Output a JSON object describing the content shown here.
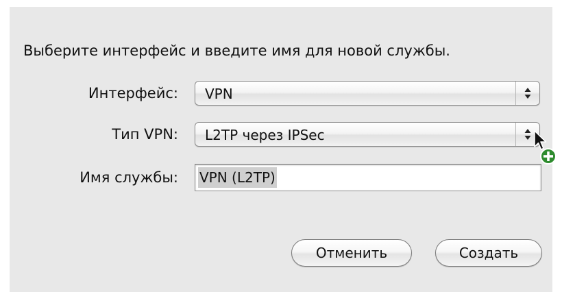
{
  "dialog": {
    "prompt": "Выберите интерфейс и введите имя для новой службы.",
    "interface": {
      "label": "Интерфейс:",
      "value": "VPN"
    },
    "vpn_type": {
      "label": "Тип VPN:",
      "value": "L2TP через IPSec"
    },
    "service_name": {
      "label": "Имя службы:",
      "value": "VPN (L2TP)"
    },
    "buttons": {
      "cancel": "Отменить",
      "create": "Создать"
    }
  },
  "icons": {
    "popup_arrows": "up-down-arrows-icon",
    "cursor": "arrow-cursor-icon",
    "copy_badge": "green-plus-icon"
  },
  "colors": {
    "sheet_background": "#e8e8e8",
    "selection": "#cfcfcf",
    "copy_badge": "#2e8b2e"
  }
}
